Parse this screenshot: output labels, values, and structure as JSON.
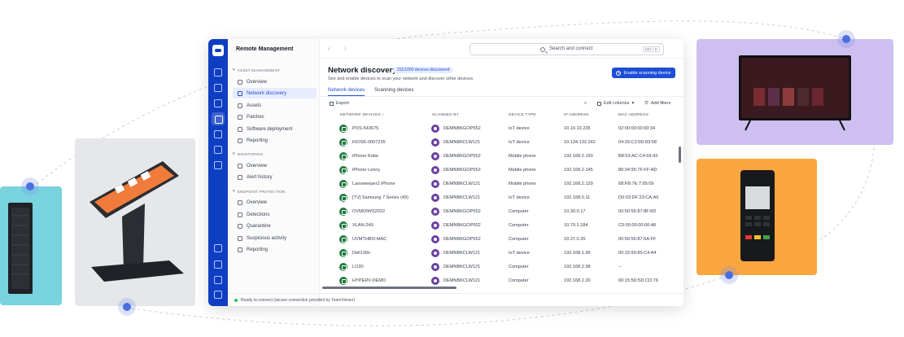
{
  "app": {
    "title": "Remote Management"
  },
  "search": {
    "placeholder": "Search and connect",
    "shortcut": "Ctrl + K"
  },
  "sidebar": {
    "sections": [
      {
        "label": "ASSET MANAGEMENT",
        "items": [
          "Overview",
          "Network discovery",
          "Assets",
          "Patches",
          "Software deployment",
          "Reporting"
        ]
      },
      {
        "label": "MONITORING",
        "items": [
          "Overview",
          "Alert history"
        ]
      },
      {
        "label": "ENDPOINT PROTECTION",
        "items": [
          "Overview",
          "Detections",
          "Quarantine",
          "Suspicious activity",
          "Reporting"
        ]
      }
    ],
    "active_item": "Network discovery"
  },
  "page": {
    "title": "Network discovery",
    "badge": "311/1000 devices discovered",
    "subtitle": "See and enable devices to scan your network and discover other devices.",
    "enable_button": "Enable scanning device",
    "tabs": [
      "Network devices",
      "Scanning devices"
    ],
    "active_tab": "Network devices",
    "toolbar": {
      "export": "Export",
      "edit_columns": "Edit columns",
      "add_filters": "Add filters"
    }
  },
  "table": {
    "columns": [
      "NETWORK DEVICES",
      "SCANNED BY",
      "DEVICE TYPE",
      "IP ADDRESS",
      "MAC ADDRESS"
    ],
    "rows": [
      [
        "POS-543675",
        "DEMNBKGOP552",
        "IoT device",
        "10.10.10.235",
        "02:00:00:00:00:34"
      ],
      [
        "KIOSK-0007235",
        "DEMNBKCLW121",
        "IoT device",
        "10.134.132.242",
        "04:33:C2:0D:83:58"
      ],
      [
        "iPhone Kobe",
        "DEMNBKGOP552",
        "Mobile phone",
        "192.168.2.150",
        "B8:53:AC:C4:69:43"
      ],
      [
        "iPhone Lenny",
        "DEMNBKGOP552",
        "Mobile phone",
        "192.168.2.145",
        "80:34:95:7F:FF:AD"
      ],
      [
        "Lansweeper2 iPhone",
        "DEMNBKCLW121",
        "Mobile phone",
        "192.168.2.129",
        "68:FB:7E:7:95:09"
      ],
      [
        "[TV] Samsung 7 Series (49)",
        "DEMNBKCLW121",
        "IoT device",
        "192.168.0.11",
        "D0:03:DF:23:CA:A5"
      ],
      [
        "OVMOIWS2022",
        "DEMNBKGOP552",
        "Computer",
        "10.30.0.17",
        "00:50:56:87:8F:6D"
      ],
      [
        "XLAN-249",
        "DEMNBKGOP552",
        "Computer",
        "10.70.1.184",
        "C0:00:00:00:00:48"
      ],
      [
        "UVMTHBO-MAC",
        "DEMNBKGOP552",
        "Computer",
        "10.37.0.35",
        "00:50:56:87:6A:FF"
      ],
      [
        "Dell130n",
        "DEMNBKCLW121",
        "IoT device",
        "192.168.1.90",
        "00:15:99:85:C4:A4"
      ],
      [
        "LO30",
        "DEMNBKCLW121",
        "Computer",
        "192.168.2.58",
        "--"
      ],
      [
        "HYPERV-DEMO",
        "DEMNBKCLW121",
        "Computer",
        "192.168.2.20",
        "00:15:5D:5D:CD:76"
      ]
    ]
  },
  "status": {
    "text": "Ready to connect (secure connection provided by TeamViewer)"
  },
  "colors": {
    "brand": "#0e3ec2",
    "accent": "#1d4ed8",
    "server_tile": "#79d3de",
    "tv_tile": "#cdbff0",
    "pos_tile": "#f9a640",
    "kiosk_tile": "#e6e7ea"
  }
}
